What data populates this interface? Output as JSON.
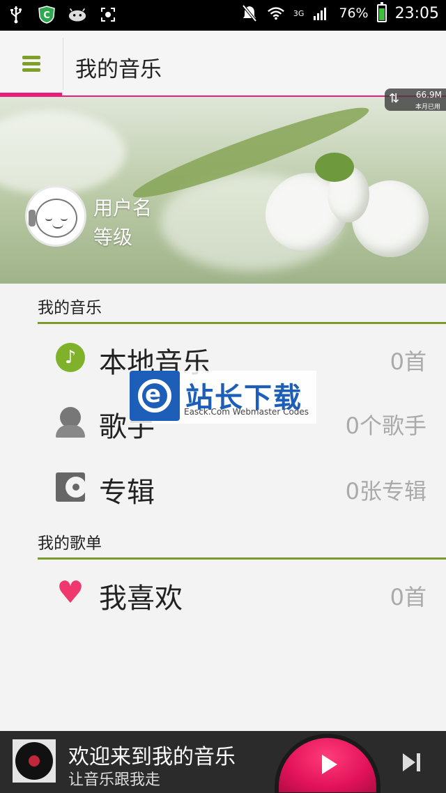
{
  "status_bar": {
    "network": "3G",
    "battery_percent": "76%",
    "time": "23:05",
    "icons": [
      "usb-icon",
      "security-shield-icon",
      "android-icon",
      "screenshot-icon",
      "mute-icon",
      "wifi-icon",
      "signal-icon",
      "battery-icon"
    ]
  },
  "app_bar": {
    "title": "我的音乐",
    "accent_color": "#e91e7a",
    "brand_green": "#7ea026"
  },
  "banner": {
    "traffic_amount": "66.9M",
    "traffic_label": "本月已用",
    "username": "用户名",
    "level": "等级"
  },
  "my_music": {
    "header": "我的音乐",
    "items": [
      {
        "label": "本地音乐",
        "count": "0首",
        "icon": "music-note-icon"
      },
      {
        "label": "歌手",
        "count": "0个歌手",
        "icon": "person-icon"
      },
      {
        "label": "专辑",
        "count": "0张专辑",
        "icon": "album-icon"
      }
    ]
  },
  "my_playlists": {
    "header": "我的歌单",
    "items": [
      {
        "label": "我喜欢",
        "count": "0首",
        "icon": "heart-icon"
      }
    ]
  },
  "watermark": {
    "title": "站长下载",
    "subtitle": "Easck.Com Webmaster Codes"
  },
  "player": {
    "song": "欢迎来到我的音乐",
    "artist": "让音乐跟我走"
  }
}
